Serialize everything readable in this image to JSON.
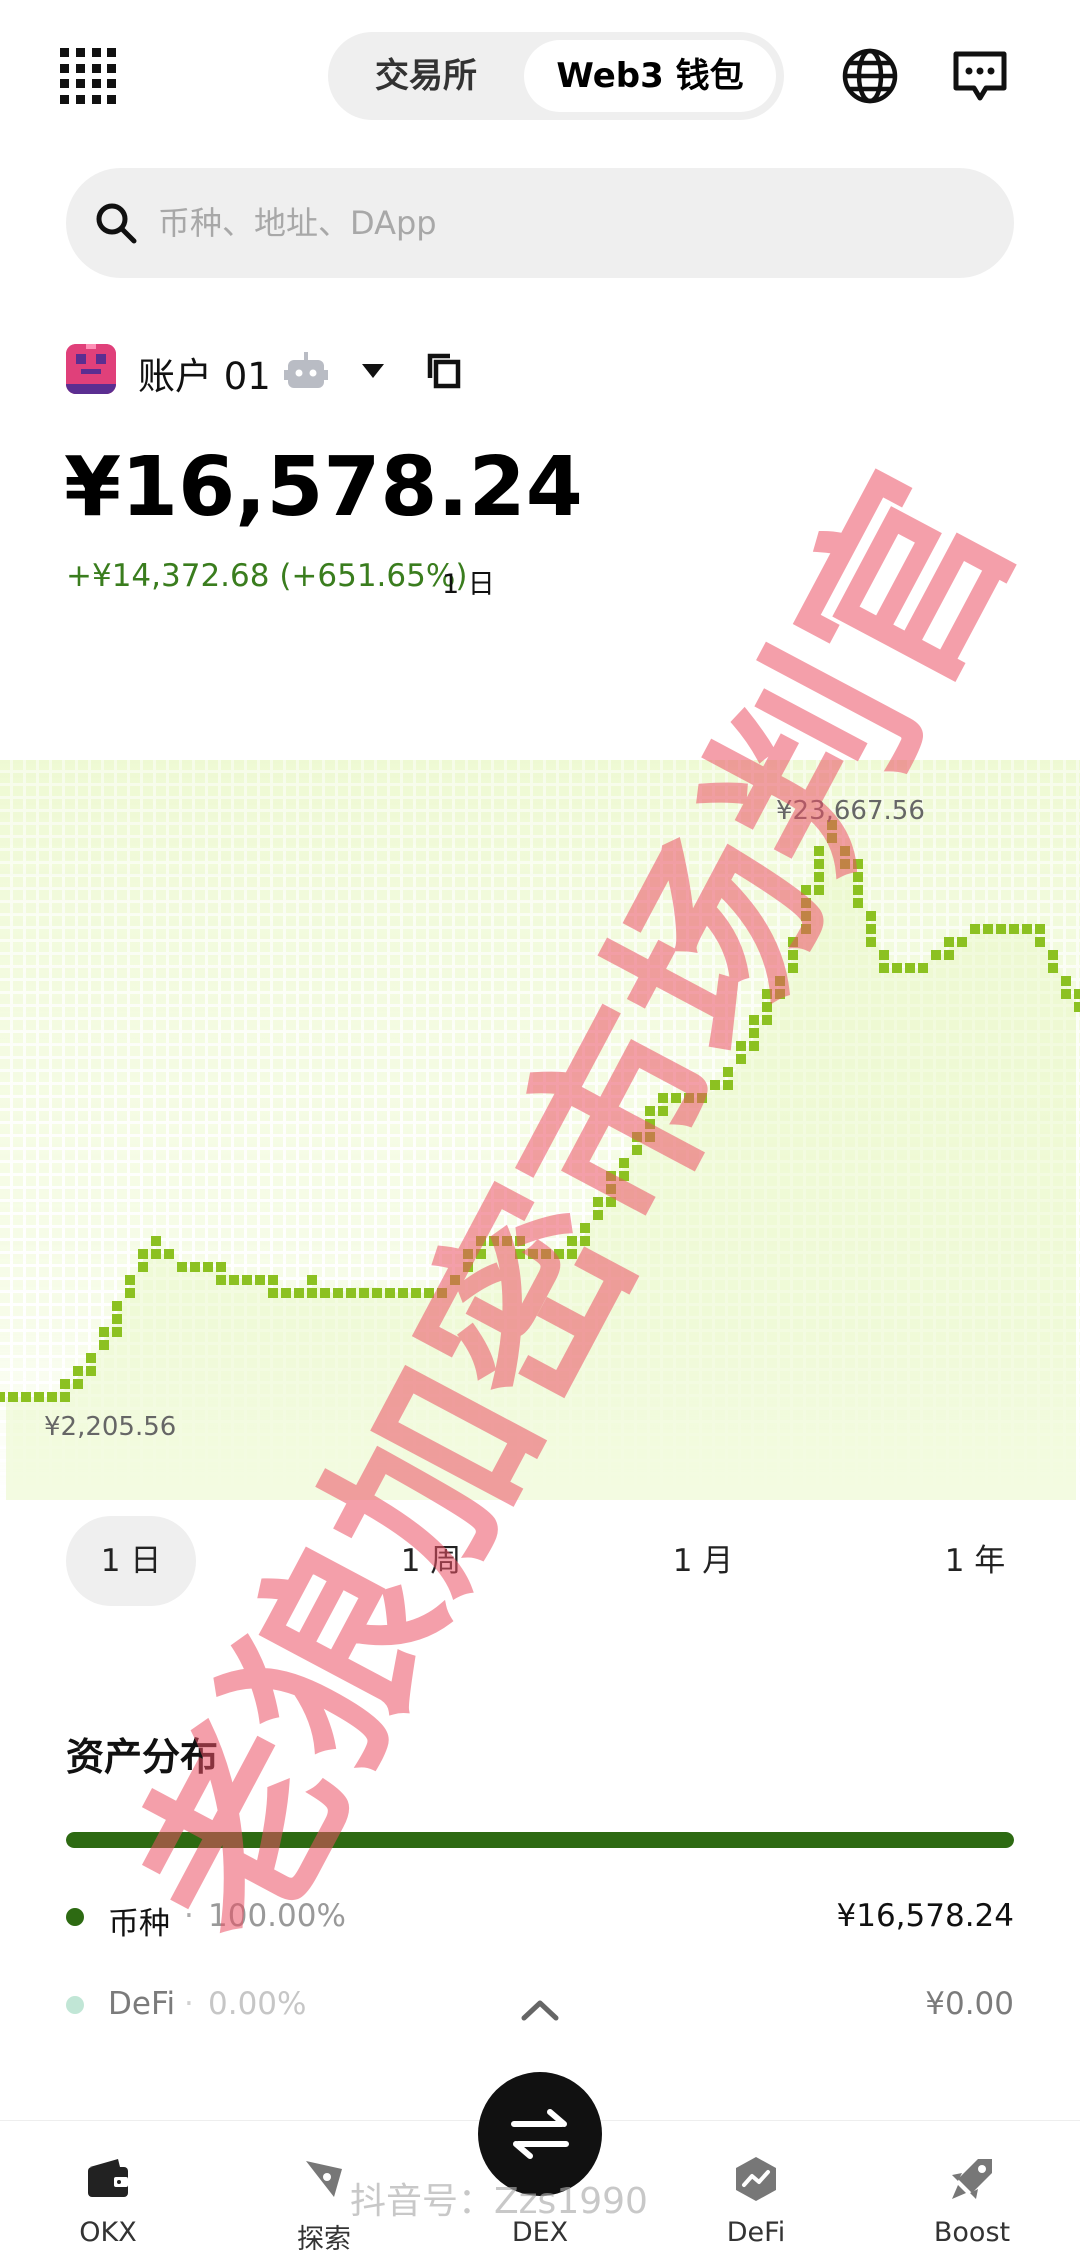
{
  "header": {
    "tabs": [
      {
        "label": "交易所",
        "active": false
      },
      {
        "label": "Web3 钱包",
        "active": true
      }
    ]
  },
  "search": {
    "placeholder": "币种、地址、DApp"
  },
  "account": {
    "name": "账户 01",
    "balance": "¥16,578.24",
    "change": "+¥14,372.68 (+651.65%)",
    "change_period": "1 日"
  },
  "chart_data": {
    "type": "line",
    "title": "",
    "x_label": "",
    "y_label": "",
    "high_label": "¥23,667.56",
    "low_label": "¥2,205.56",
    "high_value": 23667.56,
    "low_value": 2205.56,
    "values": [
      2205.56,
      2205.56,
      2205.56,
      2560,
      3380,
      4600,
      6380,
      7850,
      7450,
      7000,
      7000,
      6780,
      6560,
      6300,
      6200,
      6400,
      6100,
      6350,
      6350,
      6150,
      6150,
      6150,
      6700,
      8010,
      8010,
      7820,
      7820,
      7600,
      8200,
      9500,
      10900,
      12200,
      13400,
      13400,
      13600,
      14000,
      15200,
      16900,
      18300,
      20800,
      23667.56,
      22500,
      19800,
      18200,
      18200,
      18700,
      19200,
      19700,
      20100,
      19950,
      19700,
      18600,
      16900
    ],
    "color": "#8cc121"
  },
  "periods": [
    "1 日",
    "1 周",
    "1 月",
    "1 年"
  ],
  "period_active_index": 0,
  "watermark": "老狼加密市场判官",
  "assets": {
    "title": "资产分布",
    "bar_fraction": 1.0,
    "bar_color": "#2d6a12",
    "rows": [
      {
        "name": "币种",
        "percent": "100.00%",
        "value": "¥16,578.24",
        "color": "#2d6a12"
      },
      {
        "name": "DeFi",
        "percent": "0.00%",
        "value": "¥0.00",
        "color": "#8fd3b5"
      }
    ]
  },
  "bottom_nav": {
    "items": [
      {
        "label": "OKX",
        "icon": "wallet-icon"
      },
      {
        "label": "探索",
        "icon": "compass-icon"
      },
      {
        "label": "DEX",
        "icon": "swap-icon"
      },
      {
        "label": "DeFi",
        "icon": "chart-hex-icon"
      },
      {
        "label": "Boost",
        "icon": "rocket-icon"
      }
    ]
  },
  "overlay_text": "抖音号：Zzs1990"
}
